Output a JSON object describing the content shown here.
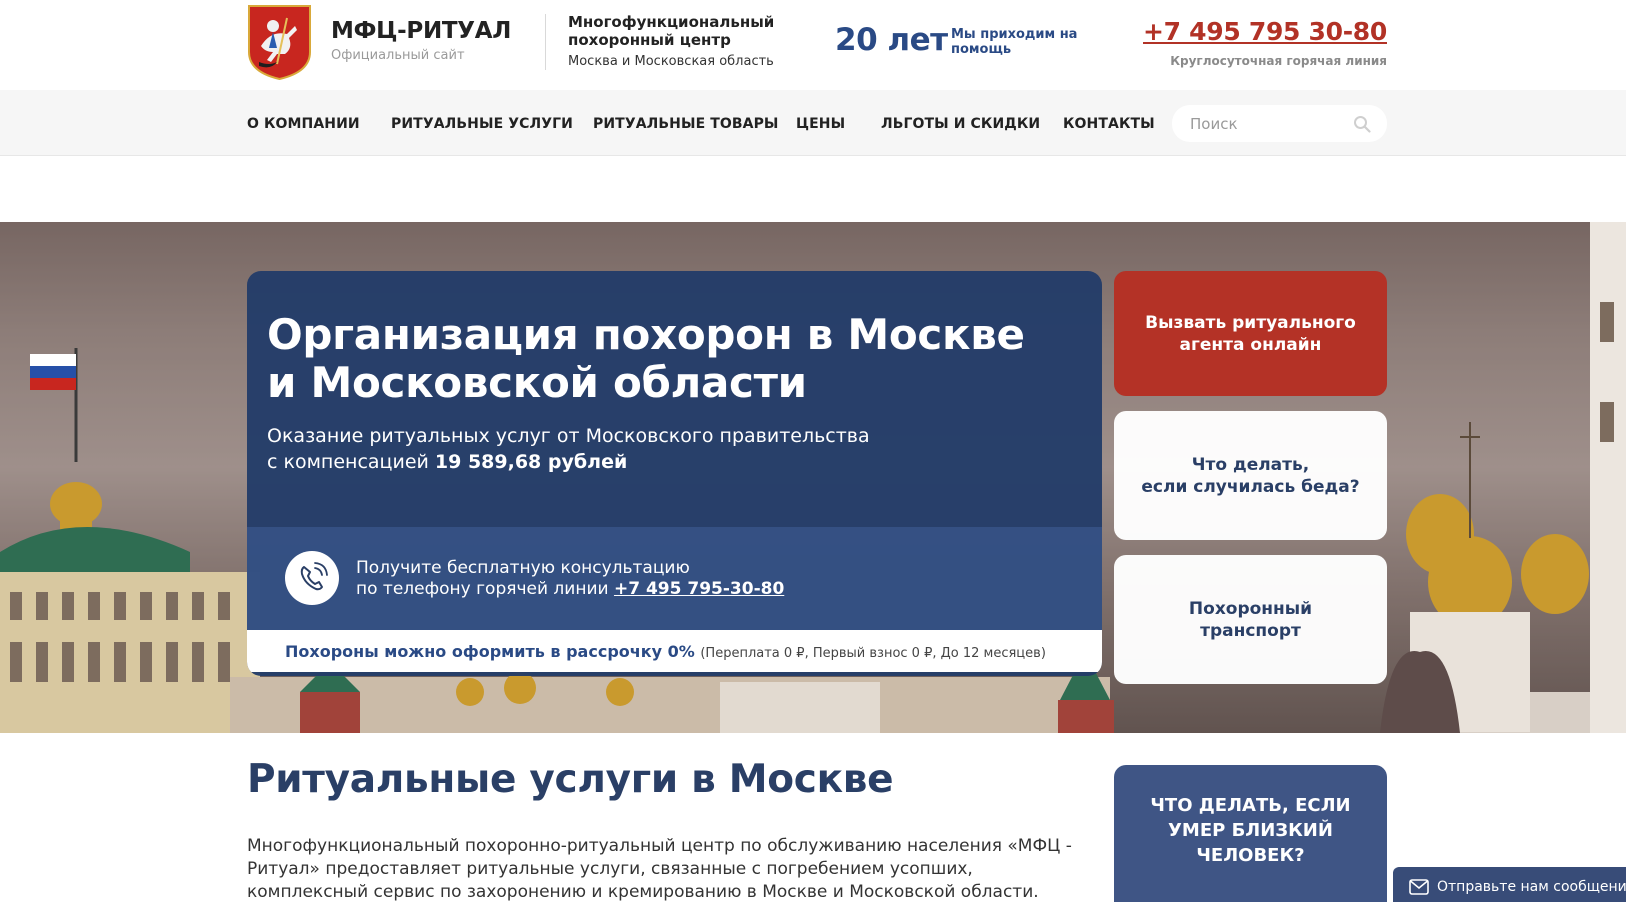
{
  "header": {
    "brand_name": "МФЦ-РИТУАЛ",
    "brand_sub": "Официальный сайт",
    "center_title": "Многофункциональный похоронный центр",
    "center_sub": "Москва и Московская область",
    "years": "20 лет",
    "years_sub": "Мы приходим на помощь",
    "phone": "+7 495 795 30-80",
    "phone_sub": "Круглосуточная горячая линия"
  },
  "nav": {
    "items": [
      {
        "label": "О КОМПАНИИ"
      },
      {
        "label": "РИТУАЛЬНЫЕ УСЛУГИ"
      },
      {
        "label": "РИТУАЛЬНЫЕ ТОВАРЫ"
      },
      {
        "label": "ЦЕНЫ"
      },
      {
        "label": "ЛЬГОТЫ И СКИДКИ"
      },
      {
        "label": "КОНТАКТЫ"
      }
    ],
    "search_placeholder": "Поиск"
  },
  "hero": {
    "title": "Организация похорон в Москве и Московской области",
    "text_line1": "Оказание ритуальных услуг от Московского правительства",
    "text_line2_prefix": "с компенсацией ",
    "text_amount": "19 589,68 рублей",
    "consult_line1": "Получите бесплатную консультацию",
    "consult_line2_prefix": "по телефону горячей линии ",
    "consult_phone": "+7 495 795-30-80",
    "installment": "Похороны можно оформить в рассрочку 0%",
    "installment_note": "(Переплата 0 ₽, Первый взнос 0 ₽, До 12 месяцев)"
  },
  "side_buttons": {
    "agent": "Вызвать ритуального\nагента онлайн",
    "what_to_do": "Что делать,\nесли случилась беда?",
    "transport": "Похоронный\nтранспорт"
  },
  "content": {
    "title": "Ритуальные услуги в Москве",
    "text": "Многофункциональный похоронно-ритуальный центр по обслуживанию населения «МФЦ - Ритуал» предоставляет ритуальные услуги, связанные с погребением усопших, комплексный сервис по захоронению и кремированию в Москве и Московской области.",
    "what_box": "ЧТО ДЕЛАТЬ, ЕСЛИ\nУМЕР БЛИЗКИЙ\nЧЕЛОВЕК?"
  },
  "message_tab": "Отправьте нам сообщение",
  "colors": {
    "brand_blue": "#2a4a85",
    "accent_red": "#b43226",
    "hero_card": "#233c69"
  }
}
